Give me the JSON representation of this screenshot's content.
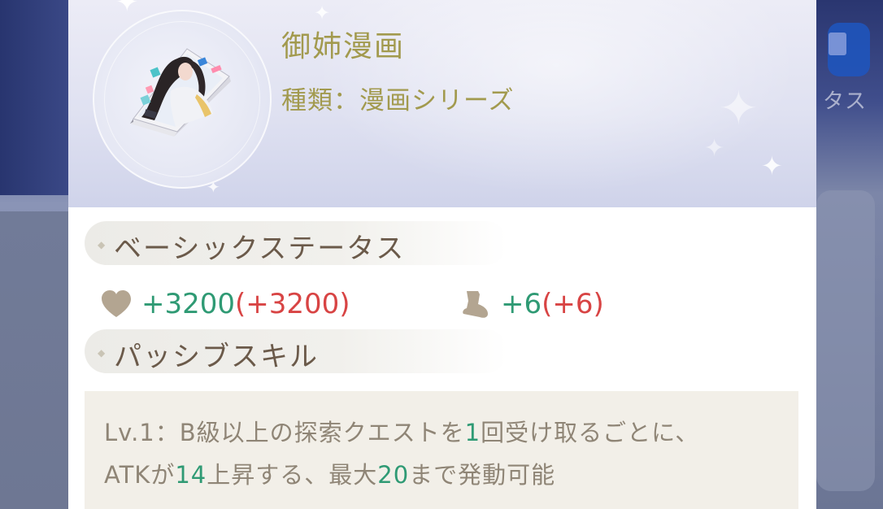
{
  "background": {
    "right_label": "タス"
  },
  "item": {
    "title": "御姉漫画",
    "type": "種類：漫画シリーズ"
  },
  "sections": {
    "basic": "ベーシックステータス",
    "passive": "パッシブスキル"
  },
  "stats": {
    "hp": {
      "icon": "heart-icon",
      "value": "+3200",
      "paren": "(+3200)"
    },
    "atk": {
      "icon": "boot-icon",
      "value": "+6",
      "paren": "(+6)"
    }
  },
  "skill": {
    "line1_a": "Lv.1：B級以上の探索クエストを",
    "line1_num": "1",
    "line1_b": "回受け取るごとに、",
    "line2_a": "ATKが",
    "line2_num1": "14",
    "line2_b": "上昇する、最大",
    "line2_num2": "20",
    "line2_c": "まで発動可能"
  },
  "colors": {
    "title": "#a29a4e",
    "positive": "#2f9a74",
    "bonus": "#d84444",
    "section_text": "#6b5a4a",
    "skill_text": "#8f8576"
  }
}
